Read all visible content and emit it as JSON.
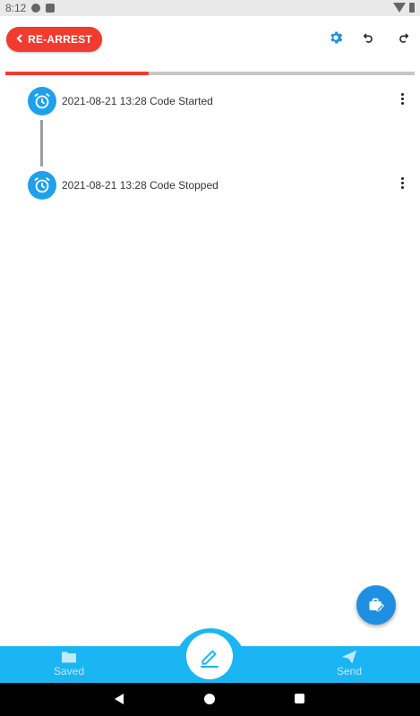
{
  "status_bar": {
    "time": "8:12"
  },
  "header": {
    "rearrest_label": "RE-ARREST",
    "icons": [
      "gear-icon",
      "undo-icon",
      "redo-icon"
    ]
  },
  "progress": {
    "fraction": 0.35
  },
  "timeline": {
    "events": [
      {
        "text": "2021-08-21 13:28 Code Started",
        "icon": "alarm-clock-icon"
      },
      {
        "text": "2021-08-21 13:28 Code Stopped",
        "icon": "alarm-clock-icon"
      }
    ]
  },
  "bottom_nav": {
    "saved_label": "Saved",
    "send_label": "Send",
    "center_icon": "edit-pencil-icon"
  },
  "colors": {
    "accent_red": "#f23b2f",
    "accent_blue": "#1ab5f2",
    "timeline_icon_blue": "#1ea0ec",
    "fab_blue": "#1e8fe1"
  }
}
